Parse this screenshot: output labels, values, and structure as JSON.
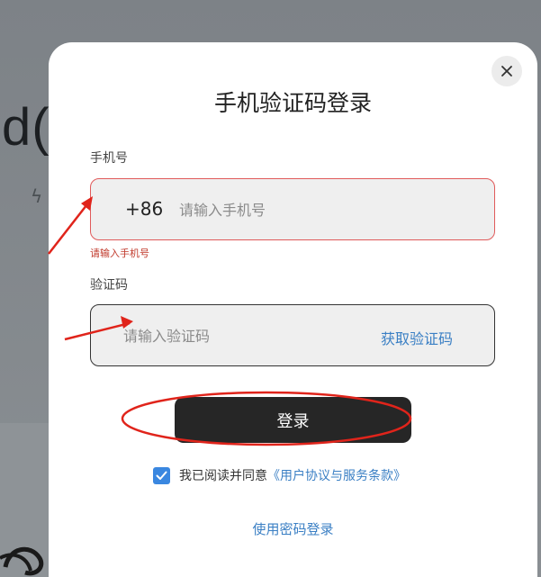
{
  "background": {
    "partial_title": "d(",
    "bolt_glyph": "ϟ"
  },
  "modal": {
    "title": "手机验证码登录",
    "close_glyph": "✕",
    "phone": {
      "label": "手机号",
      "country_code": "+86",
      "placeholder": "请输入手机号",
      "value": "",
      "error": "请输入手机号"
    },
    "code": {
      "label": "验证码",
      "placeholder": "请输入验证码",
      "value": "",
      "get_code": "获取验证码"
    },
    "login_label": "登录",
    "agreement": {
      "checked": true,
      "text": "我已阅读并同意",
      "link": "《用户协议与服务条款》"
    },
    "password_login": "使用密码登录"
  },
  "colors": {
    "accent": "#3a7fc4",
    "error": "#c0392b",
    "button": "#262626",
    "annotation": "#e0241b"
  }
}
